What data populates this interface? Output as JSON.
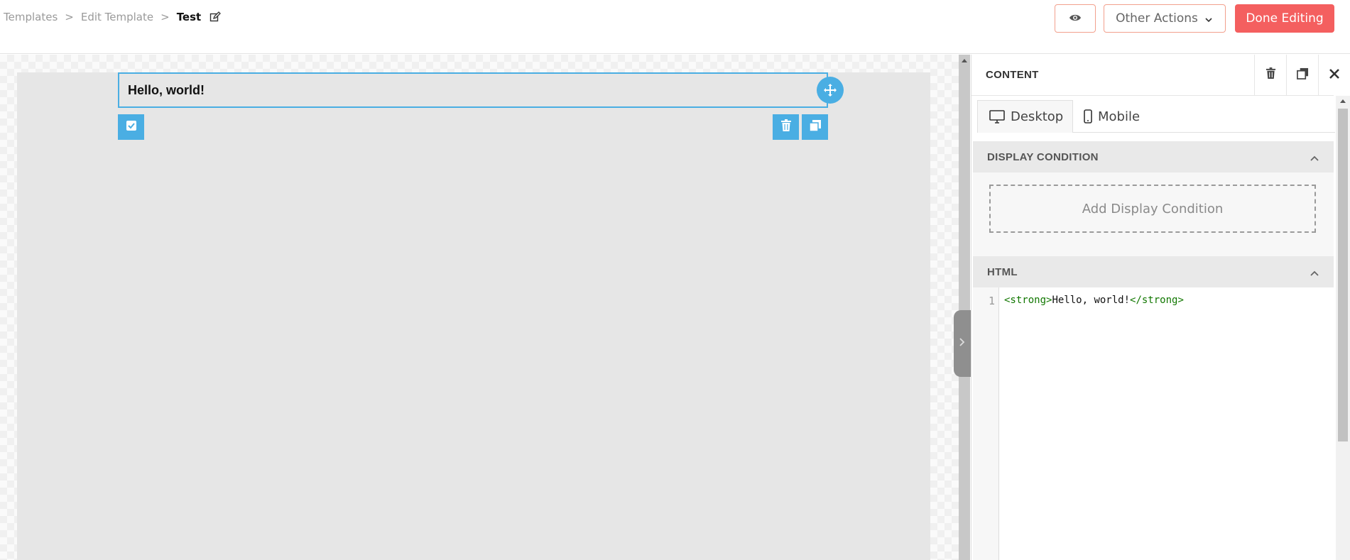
{
  "breadcrumb": {
    "items": [
      "Templates",
      "Edit Template"
    ],
    "separator": ">",
    "current": "Test"
  },
  "header": {
    "other_actions_label": "Other Actions",
    "done_label": "Done Editing"
  },
  "canvas": {
    "text_block": "Hello, world!"
  },
  "panel": {
    "title": "CONTENT",
    "tabs": [
      {
        "label": "Desktop",
        "icon": "desktop-icon",
        "active": true
      },
      {
        "label": "Mobile",
        "icon": "mobile-icon",
        "active": false
      }
    ],
    "display_condition": {
      "heading": "DISPLAY CONDITION",
      "add_label": "Add Display Condition"
    },
    "html": {
      "heading": "HTML",
      "line_number": "1",
      "open_tag": "<strong>",
      "text": "Hello, world!",
      "close_tag": "</strong>"
    }
  },
  "colors": {
    "accent": "#4aaee3",
    "done_button": "#f45f5f",
    "outline_border": "#f2a08d",
    "code_tag": "#117700"
  }
}
